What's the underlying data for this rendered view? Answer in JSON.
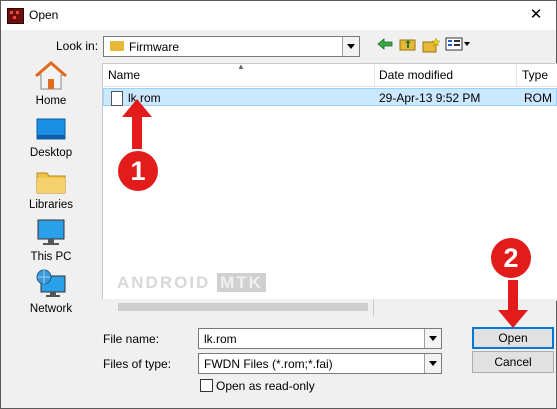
{
  "window": {
    "title": "Open",
    "close_glyph": "✕"
  },
  "toolbar": {
    "look_in_label": "Look in:",
    "look_in_value": "Firmware",
    "back_icon": "arrow-left-icon",
    "up_icon": "folder-up-icon",
    "new_folder_icon": "new-folder-icon",
    "view_icon": "view-menu-icon"
  },
  "places": [
    {
      "label": "Home",
      "icon": "home-icon"
    },
    {
      "label": "Desktop",
      "icon": "desktop-icon"
    },
    {
      "label": "Libraries",
      "icon": "libraries-icon"
    },
    {
      "label": "This PC",
      "icon": "computer-icon"
    },
    {
      "label": "Network",
      "icon": "network-icon"
    }
  ],
  "file_list": {
    "columns": [
      "Name",
      "Date modified",
      "Type"
    ],
    "rows": [
      {
        "name": "lk.rom",
        "date_modified": "29-Apr-13 9:52 PM",
        "type": "ROM"
      }
    ]
  },
  "watermark": {
    "part1": "ANDROID",
    "part2": "MTK"
  },
  "form": {
    "file_name_label": "File name:",
    "file_name_value": "lk.rom",
    "files_of_type_label": "Files of type:",
    "files_of_type_value": "FWDN Files (*.rom;*.fai)",
    "readonly_label": "Open as read-only"
  },
  "buttons": {
    "open": "Open",
    "cancel": "Cancel"
  },
  "annotations": {
    "step1": "1",
    "step2": "2"
  },
  "colors": {
    "accent": "#0078d7",
    "selection": "#cce8ff",
    "annotation": "#e31b1b"
  }
}
